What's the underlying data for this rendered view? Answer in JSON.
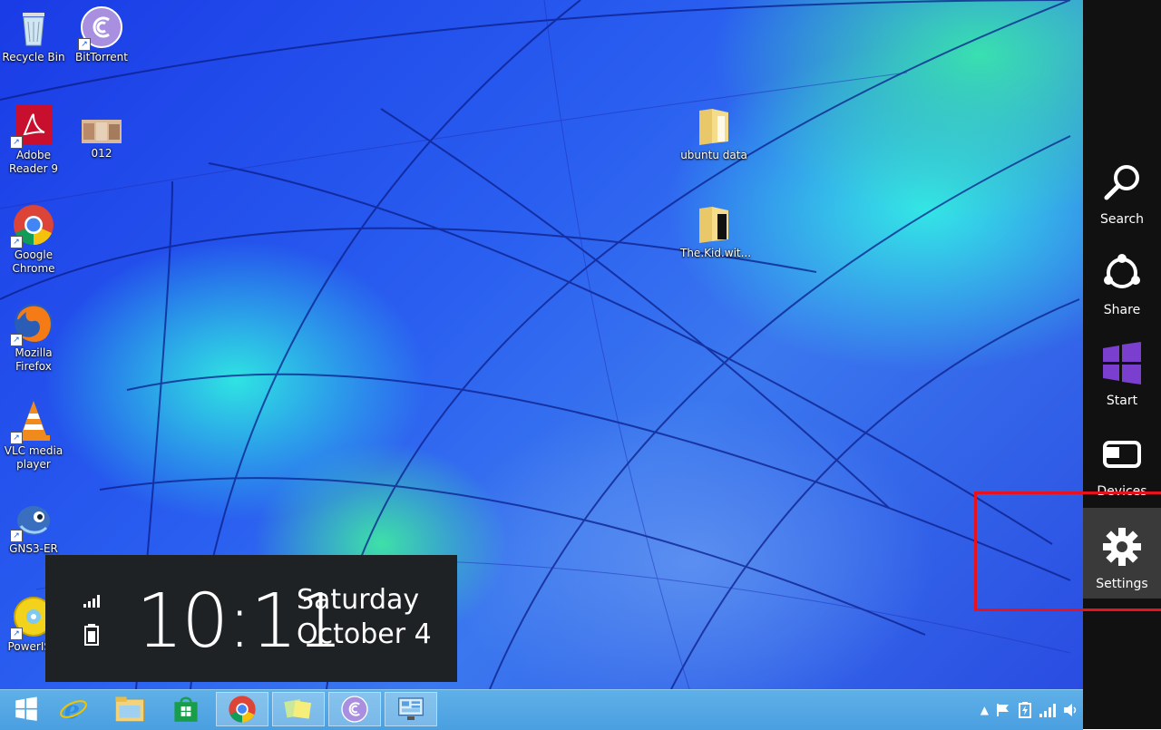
{
  "desktop": {
    "icons": [
      {
        "label": "Recycle Bin"
      },
      {
        "label": "BitTorrent"
      },
      {
        "label": "Adobe Reader 9"
      },
      {
        "label": "012"
      },
      {
        "label": "Google Chrome"
      },
      {
        "label": "Mozilla Firefox"
      },
      {
        "label": "VLC media player"
      },
      {
        "label": "GNS3-ER"
      },
      {
        "label": "PowerISO"
      },
      {
        "label": "ubuntu data"
      },
      {
        "label": "The.Kid.wit..."
      }
    ]
  },
  "clock": {
    "time": "10:11",
    "day": "Saturday",
    "date": "October 4"
  },
  "charms": [
    {
      "label": "Search",
      "icon": "search-icon"
    },
    {
      "label": "Share",
      "icon": "share-icon"
    },
    {
      "label": "Start",
      "icon": "windows-logo-icon"
    },
    {
      "label": "Devices",
      "icon": "devices-icon"
    },
    {
      "label": "Settings",
      "icon": "gear-icon",
      "active": true
    }
  ],
  "taskbar": {
    "items": [
      {
        "name": "start-button",
        "icon": "windows-logo-icon"
      },
      {
        "name": "internet-explorer",
        "icon": "ie-icon"
      },
      {
        "name": "file-explorer",
        "icon": "folder-icon"
      },
      {
        "name": "store",
        "icon": "store-icon"
      },
      {
        "name": "google-chrome",
        "icon": "chrome-icon"
      },
      {
        "name": "sticky-notes",
        "icon": "notes-icon"
      },
      {
        "name": "bittorrent",
        "icon": "bittorrent-icon"
      },
      {
        "name": "control-panel",
        "icon": "control-panel-icon"
      }
    ]
  },
  "colors": {
    "charm_bar": "#111111",
    "highlight": "#e8121e",
    "taskbar": "#4a9fe0"
  }
}
